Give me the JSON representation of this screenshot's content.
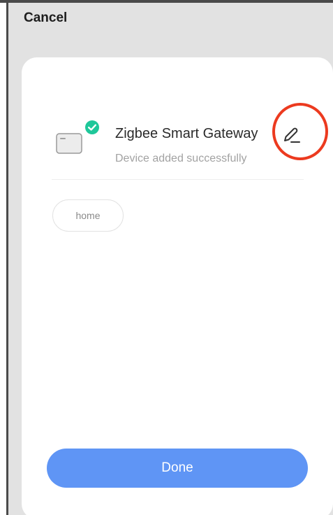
{
  "header": {
    "cancel_label": "Cancel"
  },
  "device": {
    "name": "Zigbee Smart Gateway",
    "status": "Device added successfully",
    "icon": "gateway-device-icon",
    "badge_icon": "check-circle-icon",
    "edit_icon": "pencil-icon"
  },
  "rooms": {
    "items": [
      {
        "label": "home"
      }
    ]
  },
  "footer": {
    "done_label": "Done"
  },
  "colors": {
    "accent": "#5f95f5",
    "success": "#1fc79a",
    "highlight": "#ec3a1f",
    "backdrop": "#e2e2e2"
  }
}
